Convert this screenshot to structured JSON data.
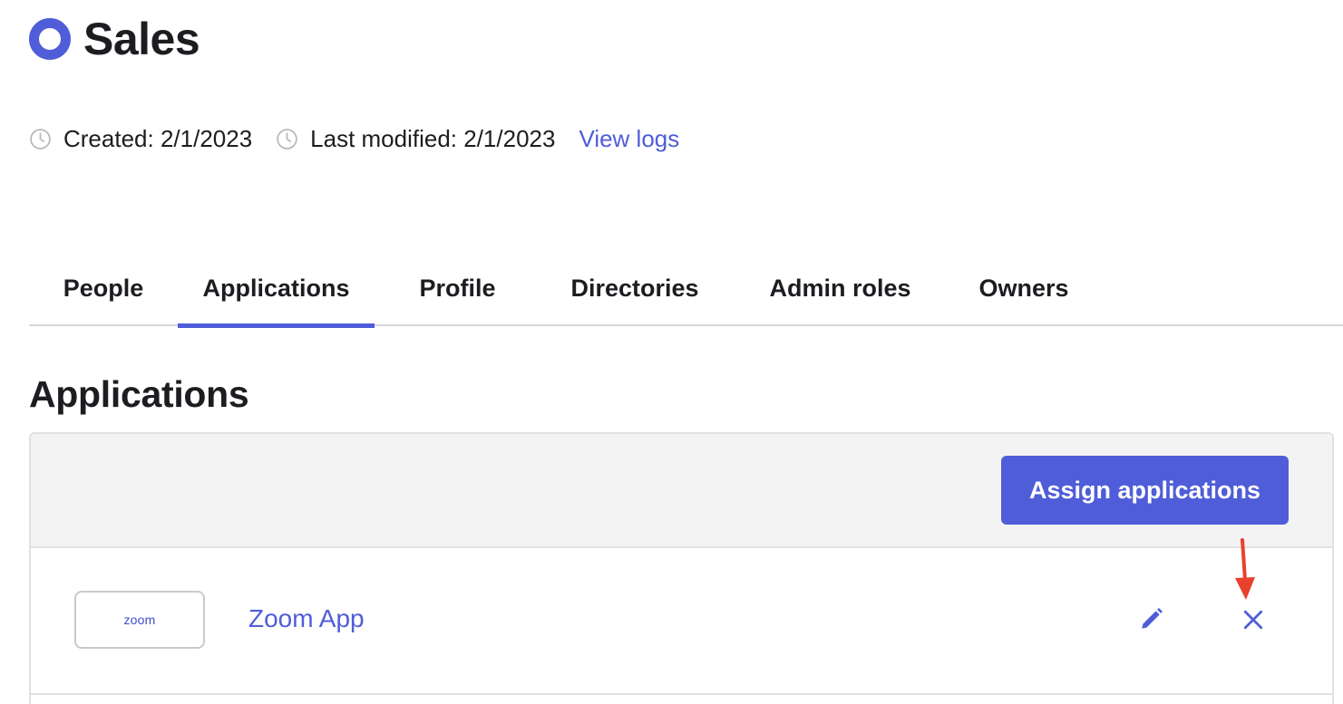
{
  "header": {
    "title": "Sales",
    "icon": "group-ring-icon",
    "accent_color": "#4f5dd8"
  },
  "meta": {
    "created": "Created: 2/1/2023",
    "last_modified": "Last modified: 2/1/2023",
    "view_logs": "View logs",
    "icon": "clock-icon"
  },
  "tabs": [
    {
      "label": "People"
    },
    {
      "label": "Applications",
      "active": true
    },
    {
      "label": "Profile"
    },
    {
      "label": "Directories"
    },
    {
      "label": "Admin roles"
    },
    {
      "label": "Owners"
    }
  ],
  "section": {
    "title": "Applications",
    "assign_button": "Assign applications"
  },
  "applications": [
    {
      "logo_text": "zoom",
      "name": "Zoom App",
      "edit_icon": "pencil-icon",
      "remove_icon": "close-icon"
    }
  ],
  "annotation": {
    "icon": "red-arrow-icon",
    "color": "#e8412c"
  }
}
